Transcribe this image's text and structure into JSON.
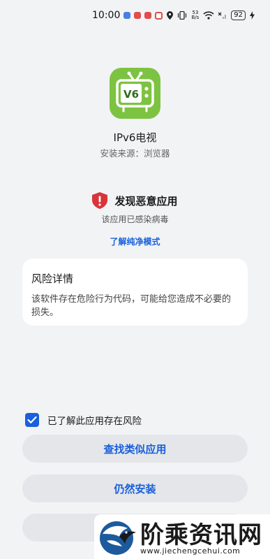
{
  "status_bar": {
    "time": "10:00",
    "net_speed_value": "53",
    "net_speed_unit": "B/s",
    "battery": "92",
    "notif_colors": [
      "#4a7fe0",
      "#e24c4c",
      "#e24c4c",
      "#e24c4c"
    ]
  },
  "app": {
    "icon_text": "V6",
    "name": "IPv6电视",
    "source": "安装来源：浏览器"
  },
  "warning": {
    "title": "发现恶意应用",
    "subtitle": "该应用已感染病毒",
    "link": "了解纯净模式"
  },
  "risk_card": {
    "title": "风险详情",
    "description": "该软件存在危险行为代码，可能给您造成不必要的损失。"
  },
  "acknowledge": {
    "label": "已了解此应用存在风险",
    "checked": true
  },
  "buttons": {
    "find_similar": "查找类似应用",
    "install_anyway": "仍然安装",
    "third": ""
  },
  "watermark": {
    "big_text": "阶乘资讯网",
    "url": "www.jiechengcehui.com"
  },
  "colors": {
    "accent": "#1a5fdb",
    "app_icon": "#7dc342",
    "warning": "#d9343a"
  }
}
